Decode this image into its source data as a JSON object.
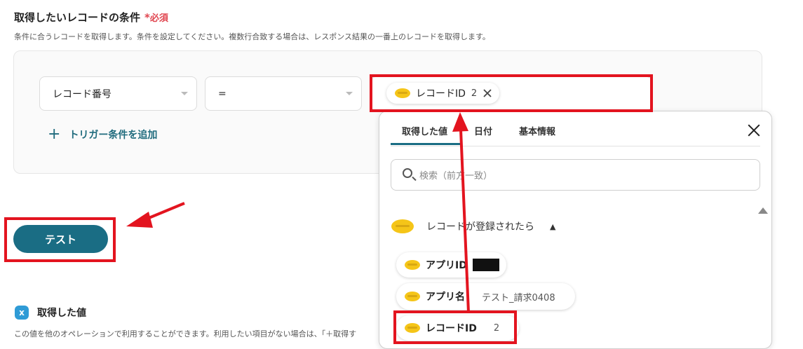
{
  "section": {
    "title": "取得したいレコードの条件",
    "required_star": "*",
    "required_label": "必須",
    "description": "条件に合うレコードを取得します。条件を設定してください。複数行合致する場合は、レスポンス結果の一番上のレコードを取得します。"
  },
  "condition": {
    "field_value": "レコード番号",
    "operator_value": "=",
    "value_chip": {
      "label": "レコードID",
      "num": "2"
    },
    "add_trigger_label": "トリガー条件を追加"
  },
  "test_button_label": "テスト",
  "result": {
    "title": "取得した値",
    "description": "この値を他のオペレーションで利用することができます。利用したい項目がない場合は、「＋取得す"
  },
  "popup": {
    "tabs": [
      {
        "label": "取得した値",
        "active": true
      },
      {
        "label": "日付",
        "active": false
      },
      {
        "label": "基本情報",
        "active": false
      }
    ],
    "search_placeholder": "検索（前方一致）",
    "group": {
      "label": "レコードが登録されたら",
      "icon": "kintone-icon",
      "expanded": true
    },
    "items": [
      {
        "label": "アプリID",
        "value_redacted": true
      },
      {
        "label": "アプリ名",
        "value": "テスト_請求0408"
      },
      {
        "label": "レコードID",
        "value": "2"
      }
    ]
  },
  "colors": {
    "accent": "#1a6d84",
    "required": "#e0454f",
    "highlight": "#e3141f",
    "kintone": "#f5c518"
  }
}
